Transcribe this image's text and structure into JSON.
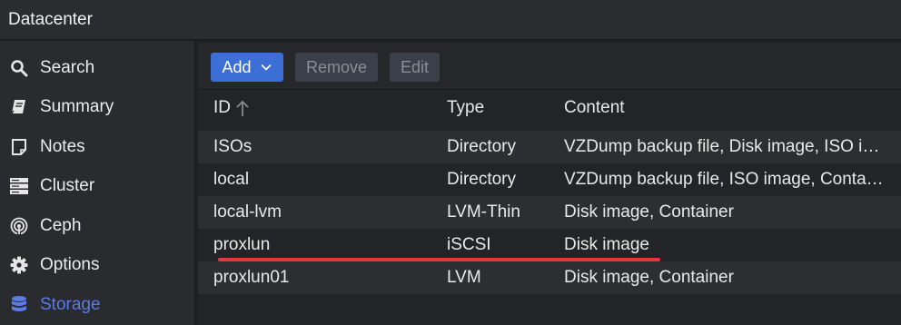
{
  "window": {
    "title": "Datacenter"
  },
  "sidebar": {
    "items": [
      {
        "label": "Search",
        "icon": "search-icon"
      },
      {
        "label": "Summary",
        "icon": "book-icon"
      },
      {
        "label": "Notes",
        "icon": "note-icon"
      },
      {
        "label": "Cluster",
        "icon": "server-icon"
      },
      {
        "label": "Ceph",
        "icon": "ceph-icon"
      },
      {
        "label": "Options",
        "icon": "gear-icon"
      },
      {
        "label": "Storage",
        "icon": "database-icon",
        "active": true
      }
    ]
  },
  "toolbar": {
    "add_label": "Add",
    "remove_label": "Remove",
    "edit_label": "Edit"
  },
  "table": {
    "headers": {
      "id": "ID",
      "type": "Type",
      "content": "Content"
    },
    "sort": {
      "column": "ID",
      "direction": "ascending"
    },
    "rows": [
      {
        "id": "ISOs",
        "type": "Directory",
        "content": "VZDump backup file, Disk image, ISO image, Container"
      },
      {
        "id": "local",
        "type": "Directory",
        "content": "VZDump backup file, ISO image, Container template"
      },
      {
        "id": "local-lvm",
        "type": "LVM-Thin",
        "content": "Disk image, Container"
      },
      {
        "id": "proxlun",
        "type": "iSCSI",
        "content": "Disk image"
      },
      {
        "id": "proxlun01",
        "type": "LVM",
        "content": "Disk image, Container"
      }
    ]
  },
  "colors": {
    "accent": "#3c6fd6",
    "active_nav": "#5b7be8",
    "highlight_line": "#e03a3e"
  }
}
